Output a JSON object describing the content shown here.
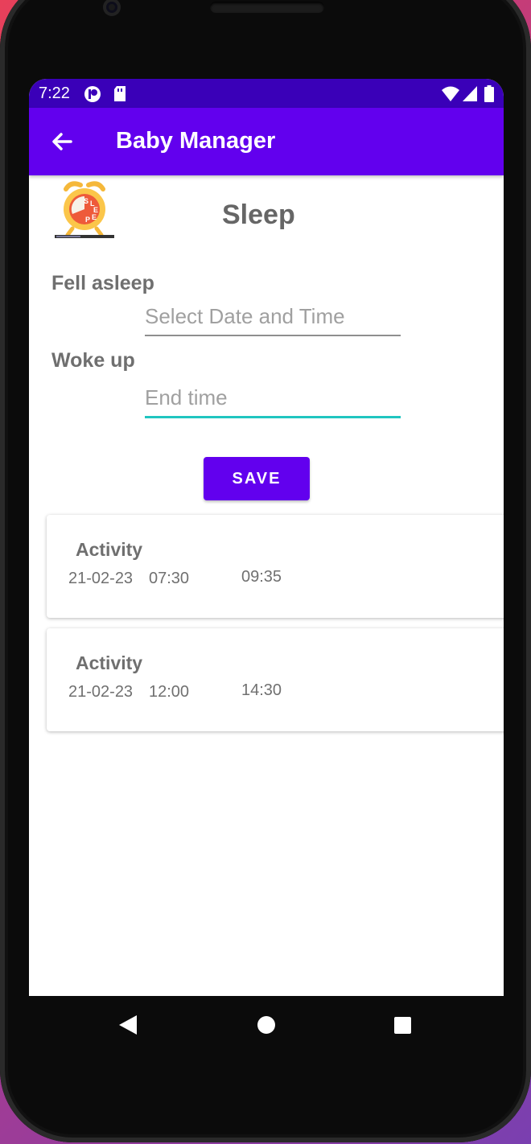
{
  "status_bar": {
    "time": "7:22",
    "icons": [
      "notification-icon",
      "sd-card-icon",
      "wifi-icon",
      "signal-icon",
      "battery-icon"
    ]
  },
  "app_bar": {
    "title": "Baby Manager",
    "back_icon": "arrow-back-icon",
    "color": "#6200ee"
  },
  "page": {
    "title": "Sleep",
    "logo_text": "SLEEP"
  },
  "form": {
    "fell_asleep_label": "Fell asleep",
    "fell_asleep_placeholder": "Select Date and Time",
    "woke_up_label": "Woke up",
    "woke_up_placeholder": "End time",
    "save_label": "SAVE"
  },
  "activities": [
    {
      "title": "Activity",
      "date": "21-02-23",
      "start": "07:30",
      "end": "09:35"
    },
    {
      "title": "Activity",
      "date": "21-02-23",
      "start": "12:00",
      "end": "14:30"
    }
  ],
  "nav_bar": {
    "icons": [
      "back-triangle-icon",
      "home-circle-icon",
      "recents-square-icon"
    ]
  },
  "colors": {
    "accent": "#6200ee",
    "status_bar": "#3a00b8",
    "focus_underline": "#20c5c0"
  }
}
